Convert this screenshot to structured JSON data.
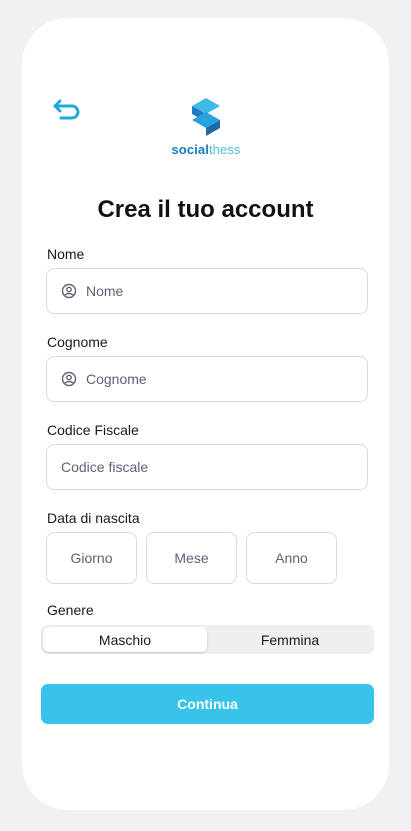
{
  "header": {
    "back_icon": "back-arrow-icon",
    "logo": {
      "word_part1": "social",
      "word_part2": "thess",
      "color_dark": "#1c7cbf",
      "color_light": "#4fbfe4"
    }
  },
  "title": "Crea il tuo account",
  "form": {
    "nome": {
      "label": "Nome",
      "placeholder": "Nome",
      "icon": "user-circle-icon"
    },
    "cognome": {
      "label": "Cognome",
      "placeholder": "Cognome",
      "icon": "user-circle-icon"
    },
    "codice_fiscale": {
      "label": "Codice Fiscale",
      "placeholder": "Codice fiscale"
    },
    "data_nascita": {
      "label": "Data di nascita",
      "giorno": "Giorno",
      "mese": "Mese",
      "anno": "Anno"
    },
    "genere": {
      "label": "Genere",
      "options": [
        "Maschio",
        "Femmina"
      ],
      "selected": "Maschio"
    }
  },
  "cta": {
    "label": "Continua",
    "color": "#37c3ea"
  },
  "colors": {
    "accent": "#37c3ea",
    "icon_back": "#1fa8df"
  }
}
